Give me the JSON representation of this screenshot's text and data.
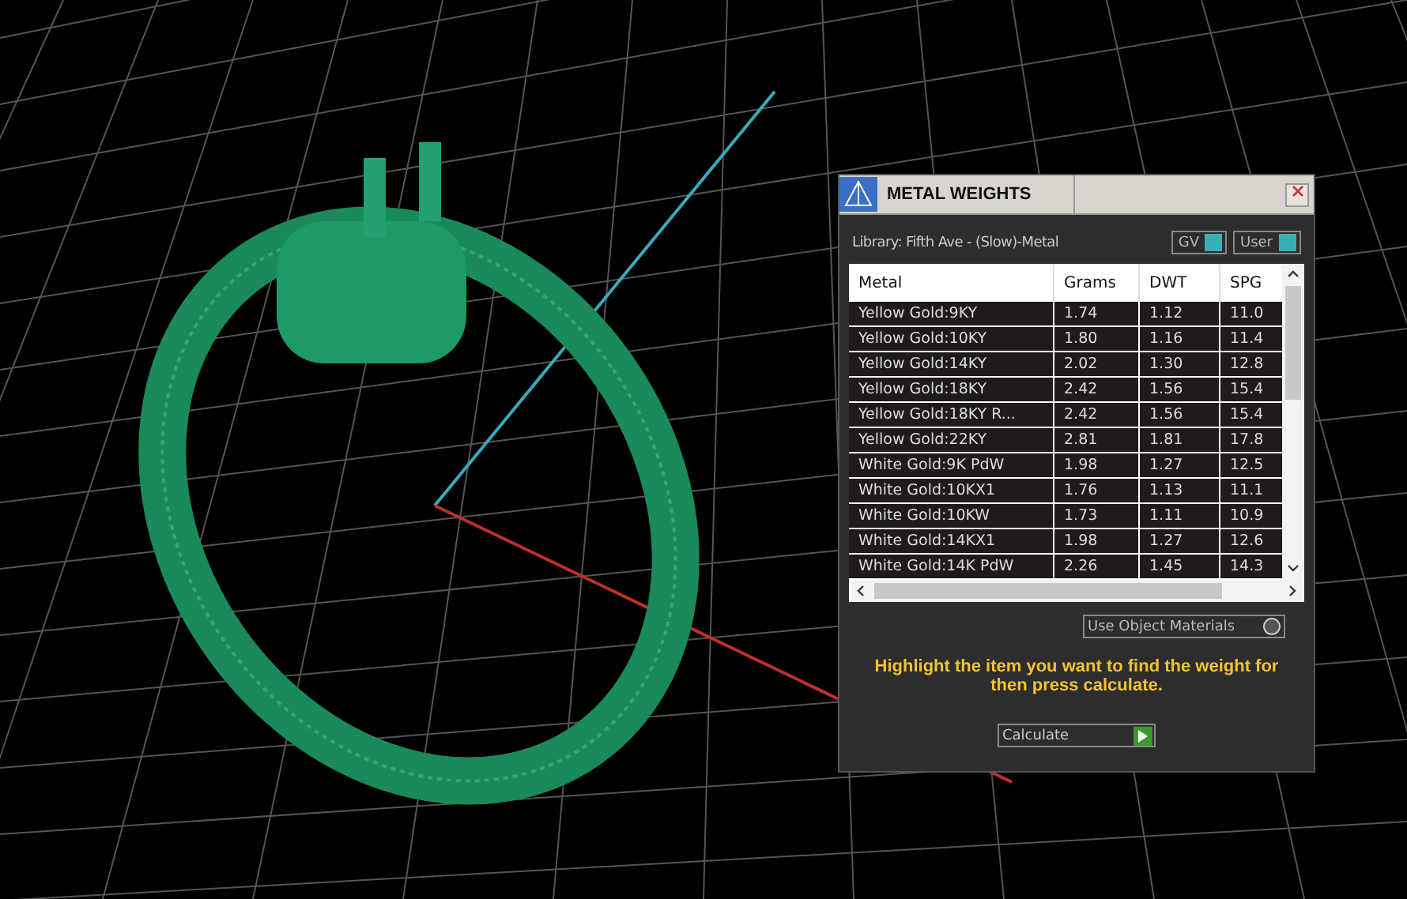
{
  "dialog": {
    "title": "METAL WEIGHTS",
    "library": "Library: Fifth Ave - (Slow)-Metal",
    "toggles": [
      {
        "label": "GV",
        "on": true
      },
      {
        "label": "User",
        "on": true
      }
    ],
    "table": {
      "columns": [
        "Metal",
        "Grams",
        "DWT",
        "SPG"
      ],
      "rows": [
        {
          "metal": "Yellow Gold:9KY",
          "grams": "1.74",
          "dwt": "1.12",
          "spg": "11.0"
        },
        {
          "metal": "Yellow Gold:10KY",
          "grams": "1.80",
          "dwt": "1.16",
          "spg": "11.4"
        },
        {
          "metal": "Yellow Gold:14KY",
          "grams": "2.02",
          "dwt": "1.30",
          "spg": "12.8"
        },
        {
          "metal": "Yellow Gold:18KY",
          "grams": "2.42",
          "dwt": "1.56",
          "spg": "15.4"
        },
        {
          "metal": "Yellow Gold:18KY R...",
          "grams": "2.42",
          "dwt": "1.56",
          "spg": "15.4"
        },
        {
          "metal": "Yellow Gold:22KY",
          "grams": "2.81",
          "dwt": "1.81",
          "spg": "17.8"
        },
        {
          "metal": "White Gold:9K PdW",
          "grams": "1.98",
          "dwt": "1.27",
          "spg": "12.5"
        },
        {
          "metal": "White Gold:10KX1",
          "grams": "1.76",
          "dwt": "1.13",
          "spg": "11.1"
        },
        {
          "metal": "White Gold:10KW",
          "grams": "1.73",
          "dwt": "1.11",
          "spg": "10.9"
        },
        {
          "metal": "White Gold:14KX1",
          "grams": "1.98",
          "dwt": "1.27",
          "spg": "12.6"
        },
        {
          "metal": "White Gold:14K PdW",
          "grams": "2.26",
          "dwt": "1.45",
          "spg": "14.3"
        }
      ]
    },
    "use_object_materials": {
      "label": "Use Object Materials",
      "on": false
    },
    "hint": "Highlight the item you want to find the weight for then press calculate.",
    "calculate_button": "Calculate"
  }
}
